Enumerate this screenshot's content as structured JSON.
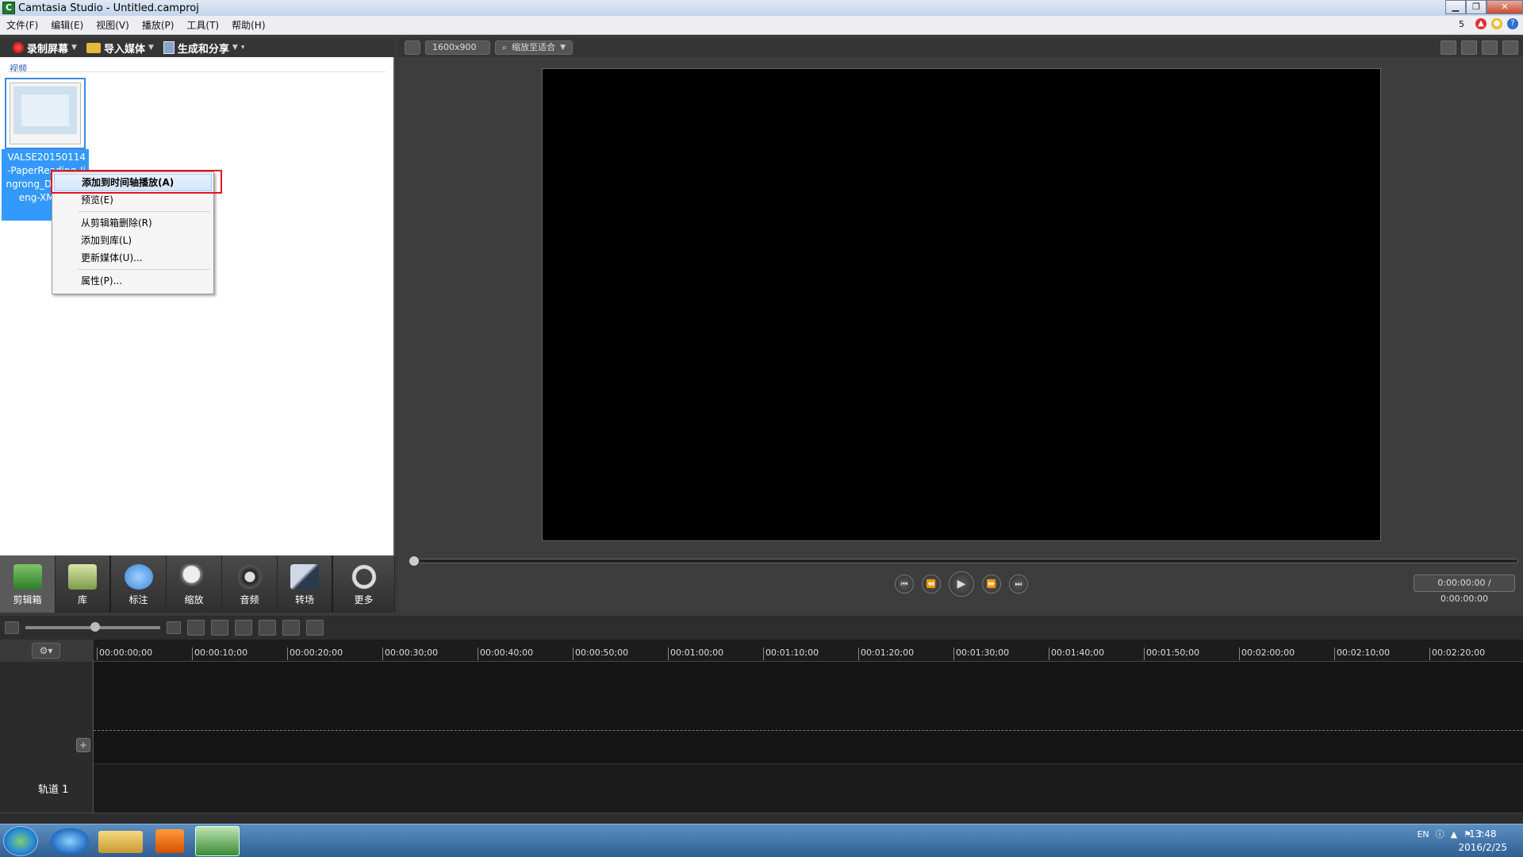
{
  "window": {
    "title": "Camtasia Studio - Untitled.camproj",
    "app_icon": "C"
  },
  "menu": [
    "文件(F)",
    "编辑(E)",
    "视图(V)",
    "播放(P)",
    "工具(T)",
    "帮助(H)"
  ],
  "menu_right": {
    "badge": "5"
  },
  "toolbar": {
    "record": "录制屏幕",
    "import": "导入媒体",
    "produce": "生成和分享"
  },
  "clipbin": {
    "section_label": "视频",
    "file_label": "VALSE20150114-PaperReading-Jingrong_Deng-Zheng-XMUN.avi"
  },
  "context_menu": {
    "items": [
      "添加到时间轴播放(A)",
      "预览(E)",
      "从剪辑箱删除(R)",
      "添加到库(L)",
      "更新媒体(U)...",
      "属性(P)..."
    ]
  },
  "tabs": [
    "剪辑箱",
    "库",
    "标注",
    "缩放",
    "音频",
    "转场",
    "更多"
  ],
  "preview": {
    "resolution": "1600x900",
    "zoom": "缩放至适合",
    "time": "0:00:00:00 / 0:00:00:00"
  },
  "timeline": {
    "ticks": [
      "00:00:00;00",
      "00:00:10;00",
      "00:00:20;00",
      "00:00:30;00",
      "00:00:40;00",
      "00:00:50;00",
      "00:01:00;00",
      "00:01:10;00",
      "00:01:20;00",
      "00:01:30;00",
      "00:01:40;00",
      "00:01:50;00",
      "00:02:00;00",
      "00:02:10;00",
      "00:02:20;00"
    ],
    "track_label": "轨道 1"
  },
  "taskbar": {
    "lang": "EN",
    "time": "13:48",
    "date": "2016/2/25"
  }
}
